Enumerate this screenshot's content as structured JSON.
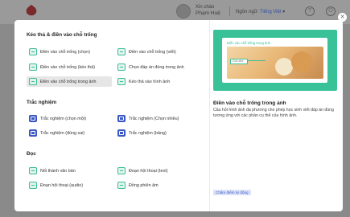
{
  "header": {
    "greeting": "Xin chào",
    "user_name": "Phạm Huệ",
    "language_label": "Ngôn ngữ:",
    "language_value": "Tiếng Việt",
    "help_icon": "question-circle-icon",
    "power_icon": "power-icon"
  },
  "modal": {
    "close_icon": "close-icon",
    "sections": [
      {
        "title": "Kéo thả & điền vào chỗ trống",
        "items": [
          {
            "label": "Điền vào chỗ trống (chọn)",
            "icon": "fill-blank-select-icon"
          },
          {
            "label": "Điền vào chỗ trống (viết)",
            "icon": "fill-blank-write-icon"
          },
          {
            "label": "Điền vào chỗ trống (kéo thả)",
            "icon": "fill-blank-drag-icon"
          },
          {
            "label": "Chọn đáp án đúng trong ảnh",
            "icon": "image-answer-icon"
          },
          {
            "label": "Điền vào chỗ trống trong ảnh",
            "icon": "image-fill-blank-icon",
            "selected": true
          },
          {
            "label": "Kéo thả vào hình ảnh",
            "icon": "drag-to-image-icon"
          }
        ]
      },
      {
        "title": "Trắc nghiệm",
        "items": [
          {
            "label": "Trắc nghiệm (chọn một)",
            "icon": "radio-list-icon"
          },
          {
            "label": "Trắc nghiệm (Chọn nhiều)",
            "icon": "checkbox-list-icon"
          },
          {
            "label": "Trắc nghiệm (đúng sai)",
            "icon": "true-false-icon"
          },
          {
            "label": "Trắc nghiệm (bảng)",
            "icon": "table-choice-icon"
          }
        ]
      },
      {
        "title": "Đọc",
        "items": [
          {
            "label": "Nối thành văn bản",
            "icon": "join-text-icon"
          },
          {
            "label": "Đoạn hội thoại (text)",
            "icon": "dialog-text-icon"
          },
          {
            "label": "Đoạn hội thoại (audio)",
            "icon": "dialog-audio-icon"
          },
          {
            "label": "Đồng phiên âm",
            "icon": "transcription-icon"
          }
        ]
      }
    ],
    "preview": {
      "heading": "Điền vào chỗ trống trong ảnh",
      "blank_text": "Con chó",
      "image_icon": "cat-dog-image",
      "title": "Điền vào chỗ trống trong ảnh",
      "description": "Câu hỏi hình ảnh đa phương cho phép học sinh viết đáp án đúng tương ứng với các phần cụ thể của hình ảnh.",
      "tag": "Chấm điểm tự động"
    }
  },
  "colors": {
    "teal": "#39c197",
    "blue": "#3a57c4"
  }
}
